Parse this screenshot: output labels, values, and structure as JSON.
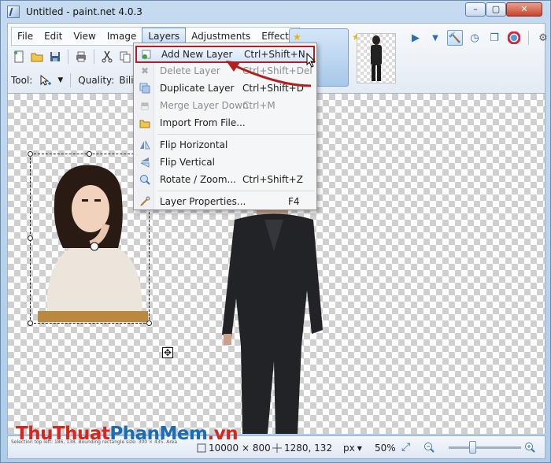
{
  "window": {
    "title": "Untitled - paint.net 4.0.3",
    "min": "–",
    "max": "▢",
    "close": "✕"
  },
  "menubar": {
    "items": [
      "File",
      "Edit",
      "View",
      "Image",
      "Layers",
      "Adjustments",
      "Effects"
    ],
    "active": "Layers"
  },
  "options": {
    "tool_label": "Tool:",
    "quality_label": "Quality:",
    "quality_value": "Bilin"
  },
  "layers_menu": [
    {
      "label": "Add New Layer",
      "shortcut": "Ctrl+Shift+N",
      "enabled": true,
      "highlighted": true
    },
    {
      "label": "Delete Layer",
      "shortcut": "Ctrl+Shift+Del",
      "enabled": false
    },
    {
      "label": "Duplicate Layer",
      "shortcut": "Ctrl+Shift+D",
      "enabled": true
    },
    {
      "label": "Merge Layer Down",
      "shortcut": "Ctrl+M",
      "enabled": false
    },
    {
      "label": "Import From File...",
      "shortcut": "",
      "enabled": true
    },
    {
      "label": "Flip Horizontal",
      "shortcut": "",
      "enabled": true
    },
    {
      "label": "Flip Vertical",
      "shortcut": "",
      "enabled": true
    },
    {
      "label": "Rotate / Zoom...",
      "shortcut": "Ctrl+Shift+Z",
      "enabled": true
    },
    {
      "label": "Layer Properties...",
      "shortcut": "F4",
      "enabled": true
    }
  ],
  "statusbar": {
    "hint": "Selection top left: 186, 138. Bounding rectangle size: 300 × 435. Area",
    "watermark_a": "ThuThuat",
    "watermark_b": "PhanMem",
    "watermark_c": ".vn",
    "image_size": "10000 × 800",
    "cursor_pos": "1280, 132",
    "units": "px",
    "zoom": "50%",
    "zoom_fraction": 0.5
  },
  "colors": {
    "highlight_border": "#b31f1f",
    "watermark_red": "#d8261d",
    "watermark_blue": "#1b6bb5"
  }
}
